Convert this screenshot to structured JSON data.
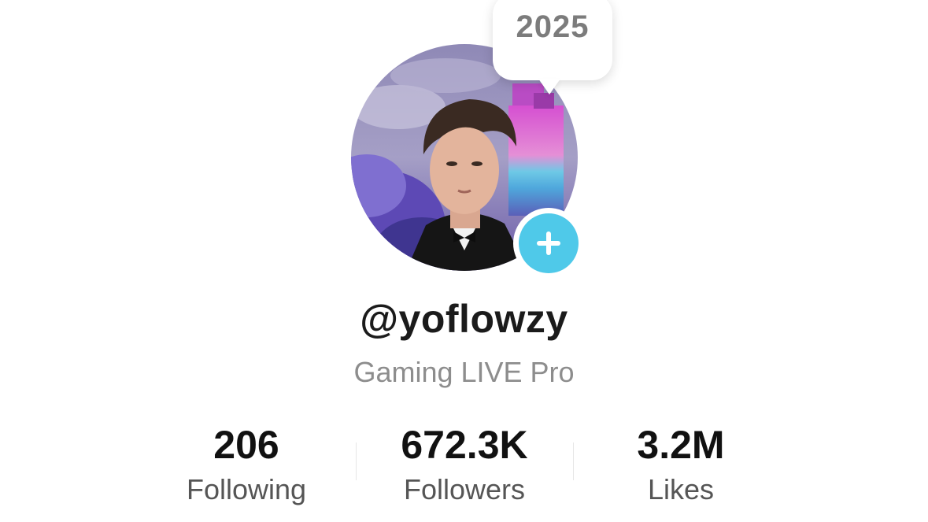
{
  "bubble": {
    "year": "2025"
  },
  "profile": {
    "username": "@yoflowzy",
    "subtitle": "Gaming LIVE Pro"
  },
  "stats": {
    "following": {
      "value": "206",
      "label": "Following"
    },
    "followers": {
      "value": "672.3K",
      "label": "Followers"
    },
    "likes": {
      "value": "3.2M",
      "label": "Likes"
    }
  },
  "icons": {
    "add": "plus-icon"
  },
  "colors": {
    "accent": "#4fc9e9",
    "username": "#1b1b1b",
    "subtitle": "#8d8d8d",
    "stat_label": "#555555"
  }
}
